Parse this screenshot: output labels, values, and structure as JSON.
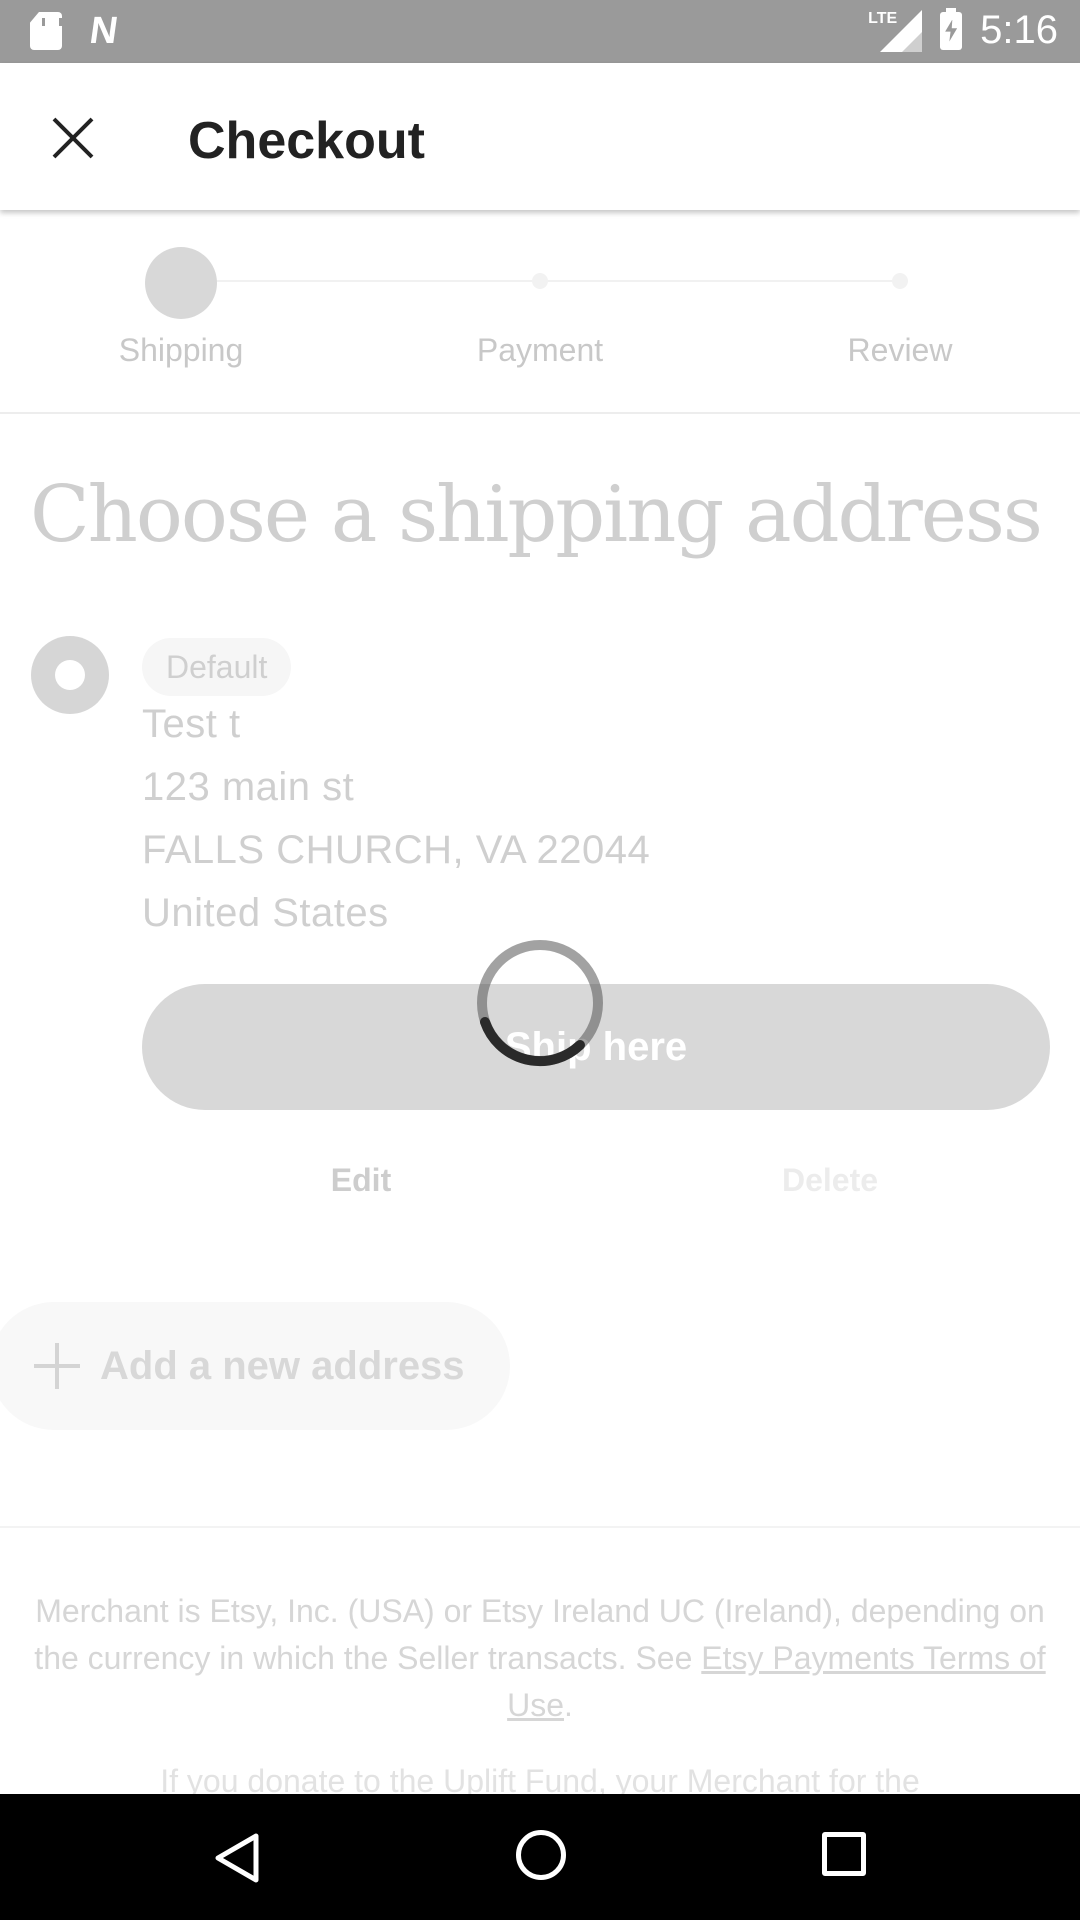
{
  "status_bar": {
    "time": "5:16",
    "network": "LTE",
    "icons": [
      "sd-card-icon",
      "n-icon",
      "lte-signal-icon",
      "battery-charging-icon"
    ]
  },
  "app_bar": {
    "title": "Checkout",
    "close_icon": "close-icon"
  },
  "stepper": {
    "steps": [
      {
        "label": "Shipping",
        "active": true
      },
      {
        "label": "Payment",
        "active": false
      },
      {
        "label": "Review",
        "active": false
      }
    ]
  },
  "main": {
    "heading": "Choose a shipping address",
    "address": {
      "badge": "Default",
      "lines": [
        "Test t",
        "123 main st",
        "FALLS CHURCH, VA 22044",
        "United States"
      ],
      "ship_here_label": "Ship here",
      "edit_label": "Edit",
      "delete_label": "Delete"
    },
    "add_address_label": "Add a new address"
  },
  "footer": {
    "merchant_text_before": "Merchant is Etsy, Inc. (USA) or Etsy Ireland UC (Ireland), depending on the currency in which the Seller transacts. See ",
    "terms_link": "Etsy Payments Terms of Use",
    "merchant_text_after": ".",
    "uplift_text": "If you donate to the Uplift Fund, your Merchant for the"
  },
  "loading": {
    "spinner_icon": "loading-spinner-icon"
  },
  "nav_bar": {
    "icons": [
      "back-icon",
      "home-icon",
      "recents-icon"
    ]
  },
  "colors": {
    "status_bar": "#9a9a9a",
    "dimmed_text": "#cfcfcf",
    "button_dimmed": "#d8d8d8",
    "nav_bar": "#000000"
  }
}
